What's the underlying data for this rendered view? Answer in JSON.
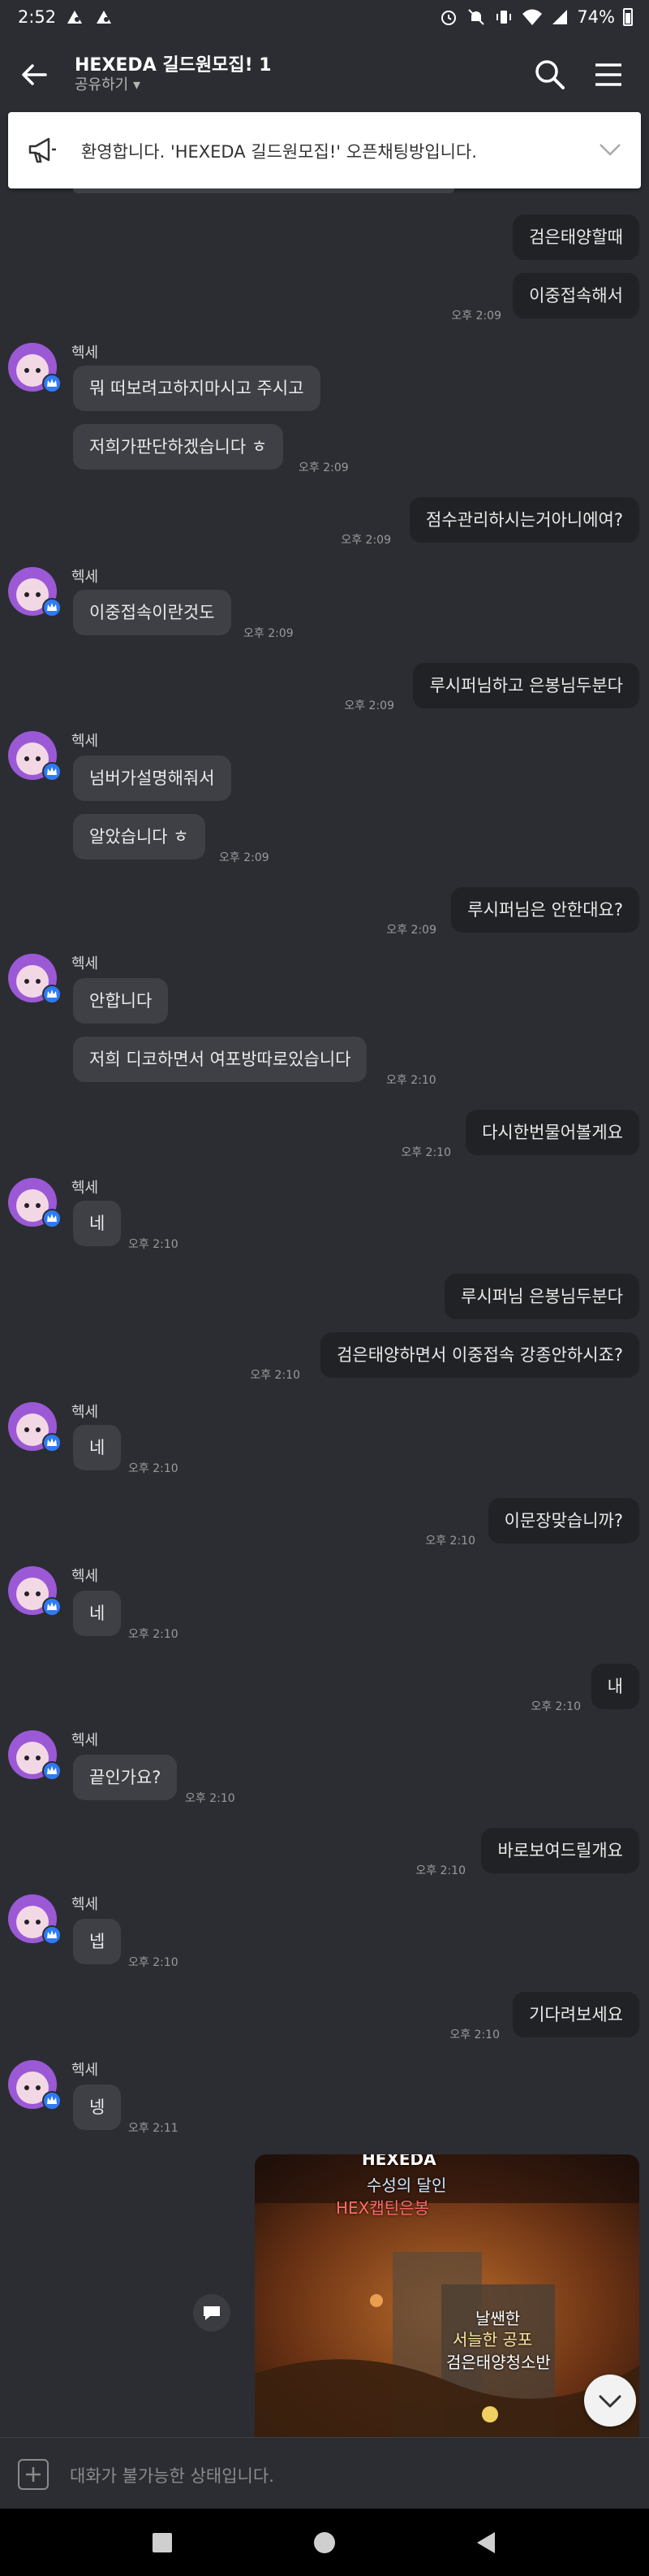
{
  "status_bar": {
    "time": "2:52",
    "battery": "74%"
  },
  "header": {
    "title": "HEXEDA 길드원모집! 1",
    "subtitle": "공유하기 ▾"
  },
  "notice": {
    "text": "환영합니다. 'HEXEDA 길드원모집!' 오픈채팅방입니다."
  },
  "colors": {
    "background": "#2b2d33",
    "my_bubble": "#212226",
    "their_bubble": "#3e4046",
    "badge": "#2e7bf6"
  },
  "sender_name": "헥세",
  "messages": [
    {
      "text": "검은태양할때"
    },
    {
      "text": "이중접속해서",
      "time": "오후 2:09"
    },
    {
      "text": "뭐 떠보려고하지마시고 주시고"
    },
    {
      "text": "저희가판단하겠습니다 ㅎ",
      "time": "오후 2:09"
    },
    {
      "text": "점수관리하시는거아니에여?",
      "time": "오후 2:09"
    },
    {
      "text": "이중접속이란것도",
      "time": "오후 2:09"
    },
    {
      "text": "루시퍼님하고 은봉님두분다",
      "time": "오후 2:09"
    },
    {
      "text": "넘버가설명해줘서"
    },
    {
      "text": "알았습니다 ㅎ",
      "time": "오후 2:09"
    },
    {
      "text": "루시퍼님은 안한대요?",
      "time": "오후 2:09"
    },
    {
      "text": "안합니다"
    },
    {
      "text": "저희 디코하면서 여포방따로있습니다",
      "time": "오후 2:10"
    },
    {
      "text": "다시한번물어볼게요",
      "time": "오후 2:10"
    },
    {
      "text": "네",
      "time": "오후 2:10"
    },
    {
      "text": "루시퍼님 은봉님두분다"
    },
    {
      "text": "검은태양하면서 이중접속 강종안하시죠?",
      "time": "오후 2:10"
    },
    {
      "text": "네",
      "time": "오후 2:10"
    },
    {
      "text": "이문장맞습니까?",
      "time": "오후 2:10"
    },
    {
      "text": "네",
      "time": "오후 2:10"
    },
    {
      "text": "내",
      "time": "오후 2:10"
    },
    {
      "text": "끝인가요?",
      "time": "오후 2:10"
    },
    {
      "text": "바로보여드릴개요",
      "time": "오후 2:10"
    },
    {
      "text": "넵",
      "time": "오후 2:10"
    },
    {
      "text": "기다려보세요",
      "time": "오후 2:10"
    },
    {
      "text": "넹",
      "time": "오후 2:11"
    }
  ],
  "photo": {
    "lines": [
      "HEXEDA",
      "수성의 달인",
      "HEX캡틴은봉",
      "날쌘한",
      "서늘한 공포",
      "검은태양청소반"
    ]
  },
  "input": {
    "placeholder": "대화가 불가능한 상태입니다."
  }
}
